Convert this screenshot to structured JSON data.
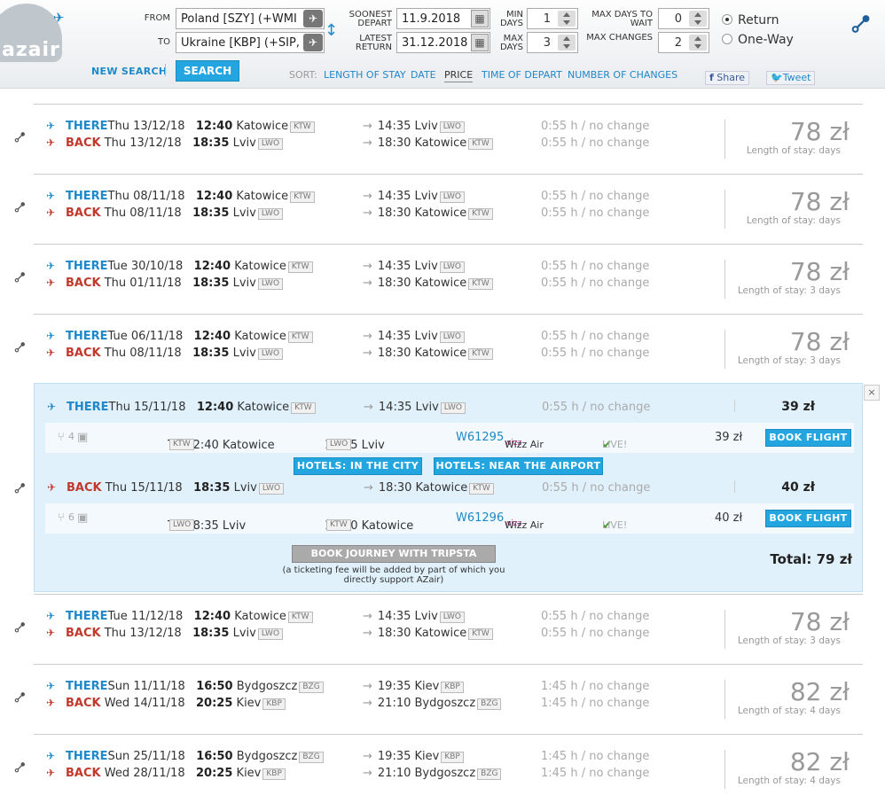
{
  "header": {
    "logo_text": "azair",
    "from_label": "FROM",
    "from_value": "Poland [SZY] (+WMI",
    "to_label": "TO",
    "to_value": "Ukraine [KBP] (+SIP,",
    "soonest_depart_label": "SOONEST DEPART",
    "soonest_depart_value": "11.9.2018",
    "latest_return_label": "LATEST RETURN",
    "latest_return_value": "31.12.2018",
    "min_days_label": "MIN DAYS",
    "min_days_value": "1",
    "max_days_label": "MAX DAYS",
    "max_days_value": "3",
    "max_days_wait_label": "MAX DAYS TO WAIT",
    "max_days_wait_value": "0",
    "max_changes_label": "MAX CHANGES",
    "max_changes_value": "2",
    "return_label": "Return",
    "oneway_label": "One-Way",
    "new_search": "NEW SEARCH",
    "search": "SEARCH",
    "sort_label": "SORT:",
    "sort_options": [
      "LENGTH OF STAY",
      "DATE",
      "PRICE",
      "TIME OF DEPART",
      "NUMBER OF CHANGES"
    ],
    "share": "Share",
    "tweet": "Tweet"
  },
  "results": [
    {
      "there_label": "THERE",
      "there_date": "Thu 13/12/18",
      "there_time": "12:40",
      "there_from": "Katowice",
      "there_from_code": "KTW",
      "there_arr_time": "14:35",
      "there_to": "Lviv",
      "there_to_code": "LWO",
      "there_dur": "0:55 h / no change",
      "back_label": "BACK",
      "back_date": "Thu 13/12/18",
      "back_time": "18:35",
      "back_from": "Lviv",
      "back_from_code": "LWO",
      "back_arr_time": "18:30",
      "back_to": "Katowice",
      "back_to_code": "KTW",
      "back_dur": "0:55 h / no change",
      "price": "78 zł",
      "stay": "Length of stay: days"
    },
    {
      "there_label": "THERE",
      "there_date": "Thu 08/11/18",
      "there_time": "12:40",
      "there_from": "Katowice",
      "there_from_code": "KTW",
      "there_arr_time": "14:35",
      "there_to": "Lviv",
      "there_to_code": "LWO",
      "there_dur": "0:55 h / no change",
      "back_label": "BACK",
      "back_date": "Thu 08/11/18",
      "back_time": "18:35",
      "back_from": "Lviv",
      "back_from_code": "LWO",
      "back_arr_time": "18:30",
      "back_to": "Katowice",
      "back_to_code": "KTW",
      "back_dur": "0:55 h / no change",
      "price": "78 zł",
      "stay": "Length of stay: days"
    },
    {
      "there_label": "THERE",
      "there_date": "Tue 30/10/18",
      "there_time": "12:40",
      "there_from": "Katowice",
      "there_from_code": "KTW",
      "there_arr_time": "14:35",
      "there_to": "Lviv",
      "there_to_code": "LWO",
      "there_dur": "0:55 h / no change",
      "back_label": "BACK",
      "back_date": "Thu 01/11/18",
      "back_time": "18:35",
      "back_from": "Lviv",
      "back_from_code": "LWO",
      "back_arr_time": "18:30",
      "back_to": "Katowice",
      "back_to_code": "KTW",
      "back_dur": "0:55 h / no change",
      "price": "78 zł",
      "stay": "Length of stay: 3 days"
    },
    {
      "there_label": "THERE",
      "there_date": "Tue 06/11/18",
      "there_time": "12:40",
      "there_from": "Katowice",
      "there_from_code": "KTW",
      "there_arr_time": "14:35",
      "there_to": "Lviv",
      "there_to_code": "LWO",
      "there_dur": "0:55 h / no change",
      "back_label": "BACK",
      "back_date": "Thu 08/11/18",
      "back_time": "18:35",
      "back_from": "Lviv",
      "back_from_code": "LWO",
      "back_arr_time": "18:30",
      "back_to": "Katowice",
      "back_to_code": "KTW",
      "back_dur": "0:55 h / no change",
      "price": "78 zł",
      "stay": "Length of stay: 3 days"
    },
    {
      "there_label": "THERE",
      "there_date": "Tue 11/12/18",
      "there_time": "12:40",
      "there_from": "Katowice",
      "there_from_code": "KTW",
      "there_arr_time": "14:35",
      "there_to": "Lviv",
      "there_to_code": "LWO",
      "there_dur": "0:55 h / no change",
      "back_label": "BACK",
      "back_date": "Thu 13/12/18",
      "back_time": "18:35",
      "back_from": "Lviv",
      "back_from_code": "LWO",
      "back_arr_time": "18:30",
      "back_to": "Katowice",
      "back_to_code": "KTW",
      "back_dur": "0:55 h / no change",
      "price": "78 zł",
      "stay": "Length of stay: 3 days"
    },
    {
      "there_label": "THERE",
      "there_date": "Sun 11/11/18",
      "there_time": "16:50",
      "there_from": "Bydgoszcz",
      "there_from_code": "BZG",
      "there_arr_time": "19:35",
      "there_to": "Kiev",
      "there_to_code": "KBP",
      "there_dur": "1:45 h / no change",
      "back_label": "BACK",
      "back_date": "Wed 14/11/18",
      "back_time": "20:25",
      "back_from": "Kiev",
      "back_from_code": "KBP",
      "back_arr_time": "21:10",
      "back_to": "Bydgoszcz",
      "back_to_code": "BZG",
      "back_dur": "1:45 h / no change",
      "price": "82 zł",
      "stay": "Length of stay: 4 days"
    },
    {
      "there_label": "THERE",
      "there_date": "Sun 25/11/18",
      "there_time": "16:50",
      "there_from": "Bydgoszcz",
      "there_from_code": "BZG",
      "there_arr_time": "19:35",
      "there_to": "Kiev",
      "there_to_code": "KBP",
      "there_dur": "1:45 h / no change",
      "back_label": "BACK",
      "back_date": "Wed 28/11/18",
      "back_time": "20:25",
      "back_from": "Kiev",
      "back_from_code": "KBP",
      "back_arr_time": "21:10",
      "back_to": "Bydgoszcz",
      "back_to_code": "BZG",
      "back_dur": "1:45 h / no change",
      "price": "82 zł",
      "stay": "Length of stay: 4 days"
    }
  ],
  "expanded": {
    "there_label": "THERE",
    "there_date": "Thu 15/11/18",
    "there_time": "12:40",
    "there_from": "Katowice",
    "there_from_code": "KTW",
    "there_arr_time": "14:35",
    "there_to": "Lviv",
    "there_to_code": "LWO",
    "there_dur": "0:55 h / no change",
    "there_price": "39 zł",
    "there_seats": "4",
    "there_detail_dep": "Th 12:40 Katowice",
    "there_detail_dep_code": "KTW",
    "there_detail_arr": "14:35 Lviv",
    "there_detail_arr_code": "LWO",
    "there_flight": "W61295",
    "airline": "Wizz Air",
    "live": "LIVE!",
    "there_detail_price": "39 zł",
    "book_flight": "BOOK FLIGHT",
    "hotels_city": "HOTELS: IN THE CITY",
    "hotels_airport": "HOTELS: NEAR THE AIRPORT",
    "back_label": "BACK",
    "back_date": "Thu 15/11/18",
    "back_time": "18:35",
    "back_from": "Lviv",
    "back_from_code": "LWO",
    "back_arr_time": "18:30",
    "back_to": "Katowice",
    "back_to_code": "KTW",
    "back_dur": "0:55 h / no change",
    "back_price": "40 zł",
    "back_seats": "6",
    "back_detail_dep": "Th 18:35 Lviv",
    "back_detail_dep_code": "LWO",
    "back_detail_arr": "18:30 Katowice",
    "back_detail_arr_code": "KTW",
    "back_flight": "W61296",
    "back_detail_price": "40 zł",
    "book_journey": "BOOK JOURNEY WITH TRIPSTA",
    "ticketing_note": "(a ticketing fee will be added by part of which you directly support AZair)",
    "total": "Total: 79 zł",
    "close": "×"
  }
}
